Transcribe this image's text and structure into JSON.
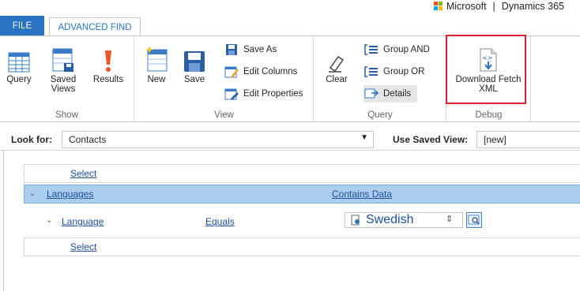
{
  "brand": {
    "microsoft": "Microsoft",
    "separator": "|",
    "product": "Dynamics 365"
  },
  "tabs": {
    "file": "FILE",
    "advanced_find": "ADVANCED FIND"
  },
  "ribbon": {
    "show": {
      "label": "Show",
      "buttons": {
        "query": "Query",
        "saved_views_1": "Saved",
        "saved_views_2": "Views",
        "results": "Results"
      }
    },
    "view": {
      "label": "View",
      "buttons": {
        "new": "New",
        "save": "Save",
        "save_as": "Save As",
        "edit_columns": "Edit Columns",
        "edit_properties": "Edit Properties"
      }
    },
    "query": {
      "label": "Query",
      "buttons": {
        "clear": "Clear",
        "group_and": "Group AND",
        "group_or": "Group OR",
        "details": "Details"
      }
    },
    "debug": {
      "label": "Debug",
      "buttons": {
        "download_fetch_xml_1": "Download Fetch",
        "download_fetch_xml_2": "XML"
      }
    }
  },
  "lookfor": {
    "label": "Look for:",
    "value": "Contacts",
    "saved_view_label": "Use Saved View:",
    "saved_view_value": "[new]"
  },
  "query_rows": {
    "select_top": "Select",
    "languages": "Languages",
    "contains_data": "Contains Data",
    "language": "Language",
    "equals": "Equals",
    "value": "Swedish",
    "select_bottom": "Select"
  },
  "colors": {
    "accent": "#2a73c2",
    "highlight_border": "#d9232e",
    "selected_row": "#a9cdef"
  },
  "icons": [
    "microsoft-logo-icon",
    "query-icon",
    "saved-views-icon",
    "results-icon",
    "new-icon",
    "save-icon",
    "save-as-icon",
    "edit-columns-icon",
    "edit-properties-icon",
    "clear-icon",
    "group-and-icon",
    "group-or-icon",
    "details-icon",
    "download-fetch-xml-icon",
    "chevron-down-icon",
    "lookup-icon",
    "record-icon",
    "spinner-icon"
  ]
}
